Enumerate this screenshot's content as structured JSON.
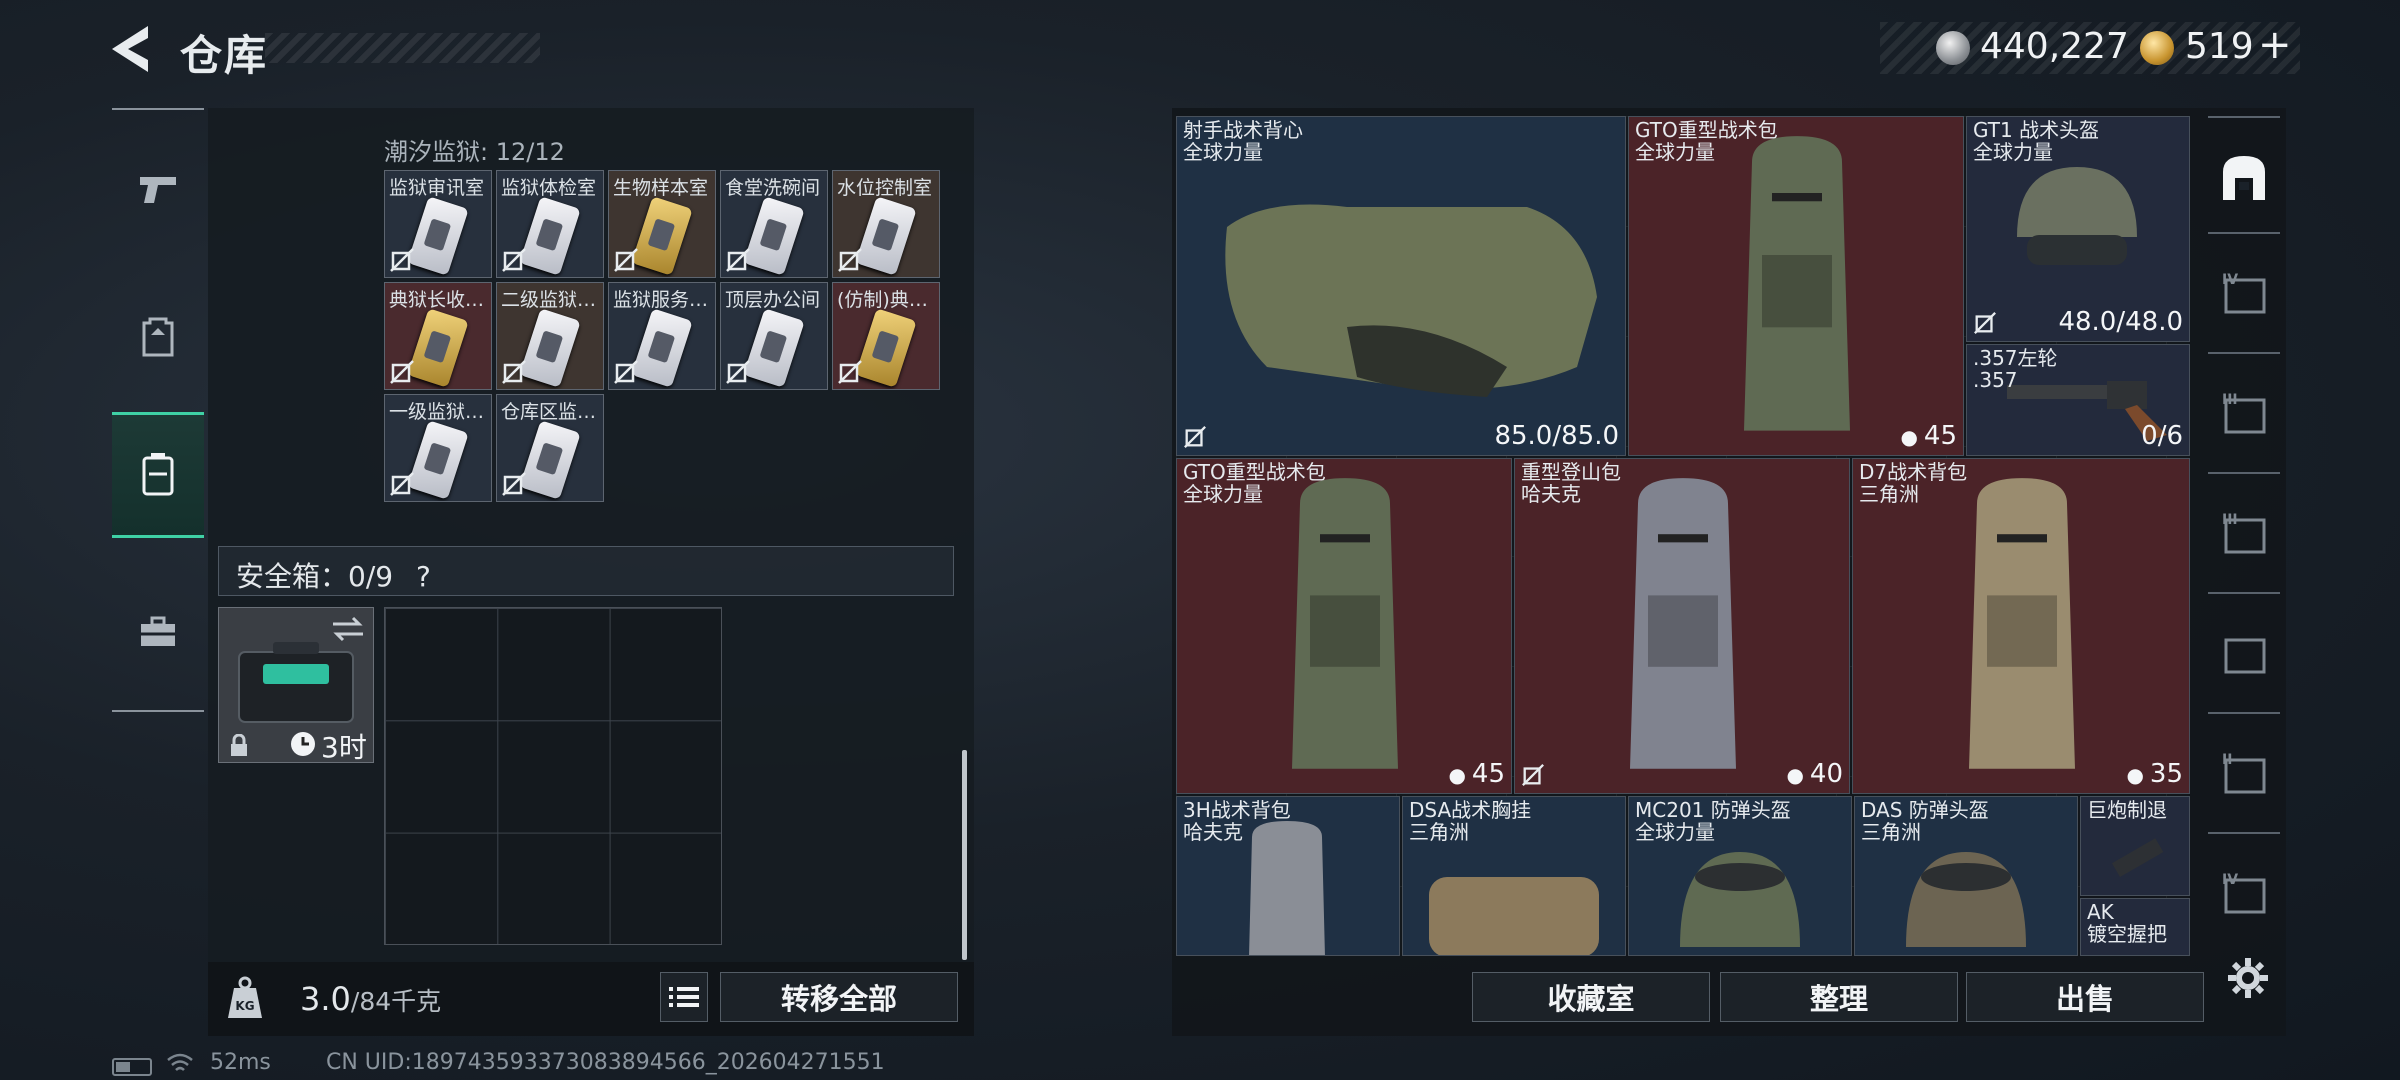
{
  "header": {
    "title": "仓库"
  },
  "currency": {
    "silver": "440,227",
    "gold": "519"
  },
  "inventory": {
    "container_label": "潮汐监狱: 12/12",
    "keys": [
      {
        "label": "监狱审讯室",
        "color": "bl",
        "gold": false
      },
      {
        "label": "监狱体检室",
        "color": "bl",
        "gold": false
      },
      {
        "label": "生物样本室",
        "color": "br",
        "gold": true
      },
      {
        "label": "食堂洗碗间",
        "color": "bl",
        "gold": false
      },
      {
        "label": "水位控制室",
        "color": "br",
        "gold": false
      },
      {
        "label": "典狱长收…",
        "color": "rd",
        "gold": true
      },
      {
        "label": "二级监狱…",
        "color": "br",
        "gold": false
      },
      {
        "label": "监狱服务…",
        "color": "bl",
        "gold": false
      },
      {
        "label": "顶层办公间",
        "color": "bl",
        "gold": false
      },
      {
        "label": "(仿制)典…",
        "color": "rd",
        "gold": true
      },
      {
        "label": "一级监狱…",
        "color": "bl",
        "gold": false
      },
      {
        "label": "仓库区监…",
        "color": "bl",
        "gold": false
      }
    ],
    "safe_label": "安全箱：0/9",
    "safe_help": "?",
    "safe_timer": "3时",
    "weight_value": "3.0",
    "weight_max": "/84千克",
    "transfer_all": "转移全部"
  },
  "storage": {
    "items": [
      {
        "name": "射手战术背心",
        "sub": "全球力量",
        "value": "85.0/85.0"
      },
      {
        "name": "GTO重型战术包",
        "sub": "全球力量",
        "value": "45"
      },
      {
        "name": "GT1 战术头盔",
        "sub": "全球力量",
        "value": "48.0/48.0"
      },
      {
        "name": ".357左轮",
        "sub": ".357",
        "value": "0/6"
      },
      {
        "name": "GTO重型战术包",
        "sub": "全球力量",
        "value": "45"
      },
      {
        "name": "重型登山包",
        "sub": "哈夫克",
        "value": "40"
      },
      {
        "name": "D7战术背包",
        "sub": "三角洲",
        "value": "35"
      },
      {
        "name": "3H战术背包",
        "sub": "哈夫克",
        "value": ""
      },
      {
        "name": "DSA战术胸挂",
        "sub": "三角洲",
        "value": ""
      },
      {
        "name": "MC201 防弹头盔",
        "sub": "全球力量",
        "value": ""
      },
      {
        "name": "DAS 防弹头盔",
        "sub": "三角洲",
        "value": ""
      },
      {
        "name": "巨炮制退",
        "sub": "",
        "value": ""
      },
      {
        "name": "AK",
        "sub": "镀空握把",
        "value": ""
      }
    ],
    "buttons": {
      "collection": "收藏室",
      "organize": "整理",
      "sell": "出售"
    }
  },
  "status_bar": {
    "ping": "52ms",
    "uid": "CN UID:18974359337308389456​6_202604271551"
  }
}
